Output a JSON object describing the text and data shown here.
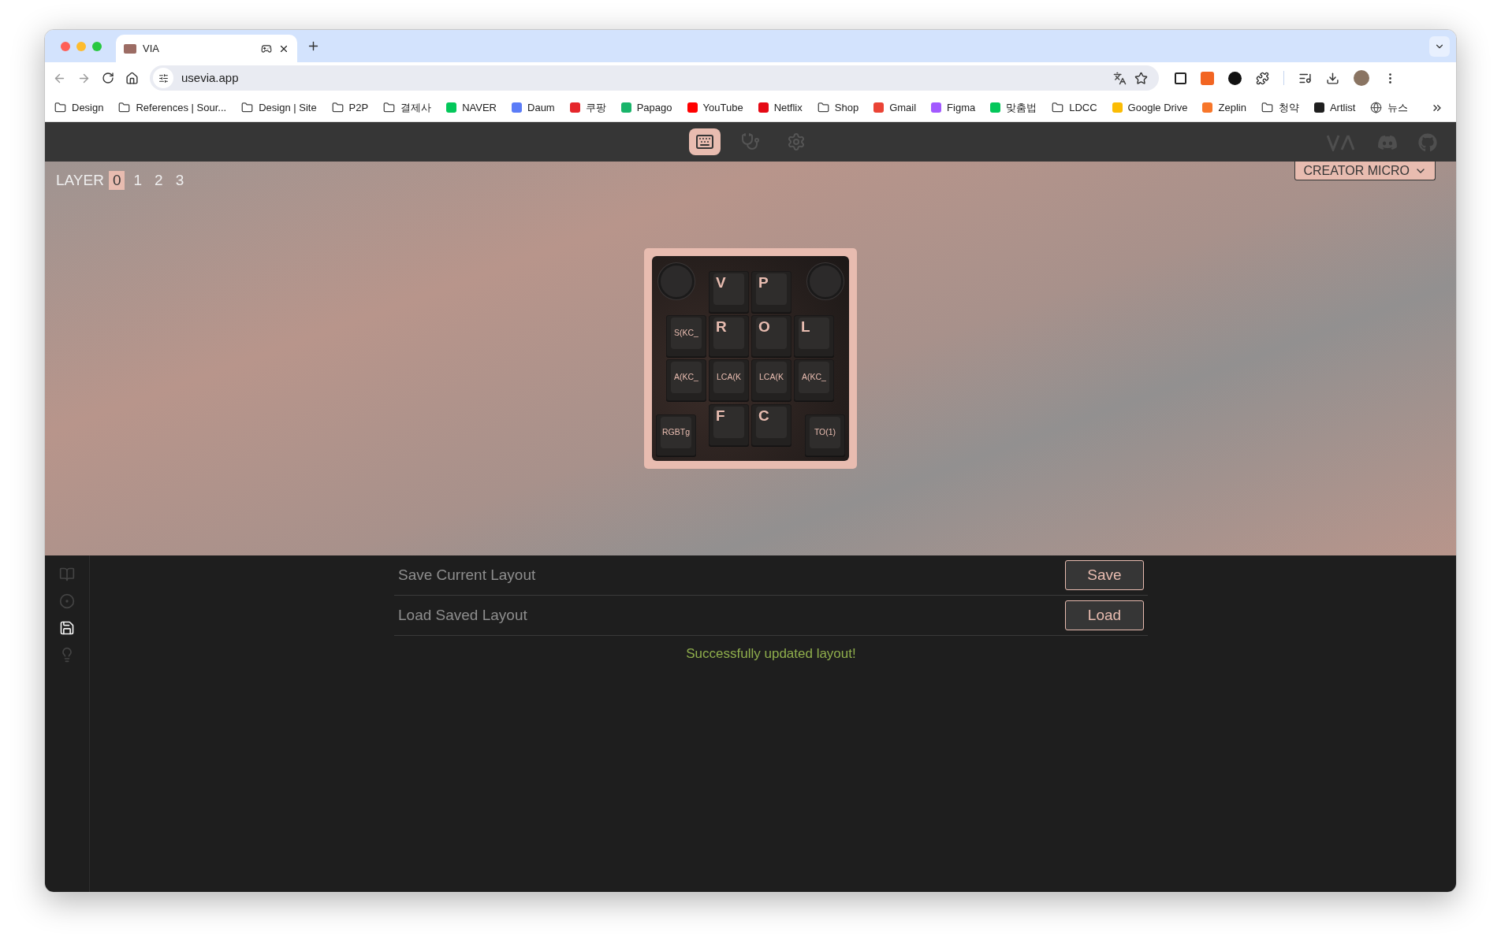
{
  "browser": {
    "tab": {
      "title": "VIA",
      "selected": true
    },
    "url": "usevia.app",
    "bookmarks": [
      {
        "label": "Design",
        "kind": "folder"
      },
      {
        "label": "References | Sour...",
        "kind": "folder"
      },
      {
        "label": "Design | Site",
        "kind": "folder"
      },
      {
        "label": "P2P",
        "kind": "folder"
      },
      {
        "label": "결제사",
        "kind": "folder"
      },
      {
        "label": "NAVER",
        "kind": "site"
      },
      {
        "label": "Daum",
        "kind": "site"
      },
      {
        "label": "쿠팡",
        "kind": "site"
      },
      {
        "label": "Papago",
        "kind": "site"
      },
      {
        "label": "YouTube",
        "kind": "site"
      },
      {
        "label": "Netflix",
        "kind": "site"
      },
      {
        "label": "Shop",
        "kind": "folder"
      },
      {
        "label": "Gmail",
        "kind": "site"
      },
      {
        "label": "Figma",
        "kind": "site"
      },
      {
        "label": "맞춤법",
        "kind": "site"
      },
      {
        "label": "LDCC",
        "kind": "folder"
      },
      {
        "label": "Google Drive",
        "kind": "site"
      },
      {
        "label": "Zeplin",
        "kind": "site"
      },
      {
        "label": "청약",
        "kind": "folder"
      },
      {
        "label": "Artlist",
        "kind": "site"
      },
      {
        "label": "뉴스",
        "kind": "globe"
      }
    ]
  },
  "nav": [
    {
      "selected": true
    },
    {
      "selected": false
    },
    {
      "selected": false
    }
  ],
  "layer": {
    "label": "LAYER",
    "layers": [
      {
        "label": "0",
        "selected": true
      },
      {
        "label": "1",
        "selected": false
      },
      {
        "label": "2",
        "selected": false
      },
      {
        "label": "3",
        "selected": false
      }
    ]
  },
  "device_menu": {
    "label": "CREATOR MICRO"
  },
  "keys": [
    {
      "kind": "knob"
    },
    {
      "kind": "letter",
      "label": "V"
    },
    {
      "kind": "letter",
      "label": "P"
    },
    {
      "kind": "knob"
    },
    {
      "kind": "code",
      "label": "S(KC_"
    },
    {
      "kind": "letter",
      "label": "R"
    },
    {
      "kind": "letter",
      "label": "O"
    },
    {
      "kind": "letter",
      "label": "L"
    },
    {
      "kind": "code",
      "label": "A(KC_"
    },
    {
      "kind": "code",
      "label": "LCA(K"
    },
    {
      "kind": "code",
      "label": "LCA(K"
    },
    {
      "kind": "code",
      "label": "A(KC_"
    },
    {
      "kind": "letter",
      "label": "F"
    },
    {
      "kind": "letter",
      "label": "C"
    },
    {
      "kind": "code",
      "label": "RGBTg"
    },
    {
      "kind": "code",
      "label": "TO(1)"
    }
  ],
  "sidebar": [
    {
      "selected": false
    },
    {
      "selected": false
    },
    {
      "selected": true
    },
    {
      "selected": false
    }
  ],
  "layout_actions": [
    {
      "label": "Save Current Layout",
      "button": "Save"
    },
    {
      "label": "Load Saved Layout",
      "button": "Load"
    }
  ],
  "status": "Successfully updated layout!"
}
